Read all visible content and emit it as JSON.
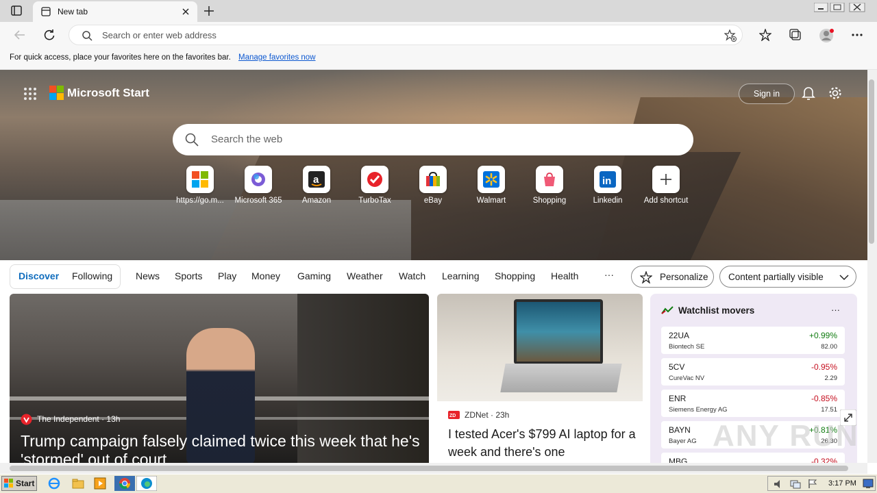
{
  "browser": {
    "tab_title": "New tab",
    "address_placeholder": "Search or enter web address",
    "favorites_bar_text": "For quick access, place your favorites here on the favorites bar.",
    "favorites_bar_link": "Manage favorites now"
  },
  "page": {
    "brand": "Microsoft Start",
    "signin_label": "Sign in",
    "search_placeholder": "Search the web",
    "shortcuts": [
      {
        "label": "https://go.m...",
        "icon": "windows-logo-icon"
      },
      {
        "label": "Microsoft 365",
        "icon": "microsoft365-icon"
      },
      {
        "label": "Amazon",
        "icon": "amazon-icon"
      },
      {
        "label": "TurboTax",
        "icon": "turbotax-icon"
      },
      {
        "label": "eBay",
        "icon": "ebay-icon"
      },
      {
        "label": "Walmart",
        "icon": "walmart-icon"
      },
      {
        "label": "Shopping",
        "icon": "shopping-bag-icon"
      },
      {
        "label": "Linkedin",
        "icon": "linkedin-icon"
      },
      {
        "label": "Add shortcut",
        "icon": "plus-icon"
      }
    ],
    "nav": {
      "segment": [
        "Discover",
        "Following"
      ],
      "tabs": [
        "News",
        "Sports",
        "Play",
        "Money",
        "Gaming",
        "Weather",
        "Watch",
        "Learning",
        "Shopping",
        "Health"
      ],
      "more": "···",
      "personalize": "Personalize",
      "content_visibility": "Content partially visible"
    },
    "cards": {
      "main": {
        "source": "The Independent · 13h",
        "title": "Trump campaign falsely claimed twice this week that he's 'stormed' out of court"
      },
      "second": {
        "source": "ZDNet · 23h",
        "title": "I tested Acer's $799 AI laptop for a week and there's one"
      }
    },
    "watchlist": {
      "title": "Watchlist movers",
      "more": "···",
      "rows": [
        {
          "symbol": "22UA",
          "name": "Biontech SE",
          "change": "+0.99%",
          "price": "82.00",
          "direction": "up"
        },
        {
          "symbol": "5CV",
          "name": "CureVac NV",
          "change": "-0.95%",
          "price": "2.29",
          "direction": "down"
        },
        {
          "symbol": "ENR",
          "name": "Siemens Energy AG",
          "change": "-0.85%",
          "price": "17.51",
          "direction": "down"
        },
        {
          "symbol": "BAYN",
          "name": "Bayer AG",
          "change": "+0.81%",
          "price": "26.30",
          "direction": "up"
        },
        {
          "symbol": "MBG",
          "name": "",
          "change": "-0.32%",
          "price": "",
          "direction": "down"
        }
      ]
    }
  },
  "taskbar": {
    "start_label": "Start",
    "clock": "3:17 PM"
  },
  "watermark": "ANY RUN",
  "colors": {
    "accent": "#0f6cbd",
    "up": "#107c10",
    "down": "#c50f1f"
  }
}
